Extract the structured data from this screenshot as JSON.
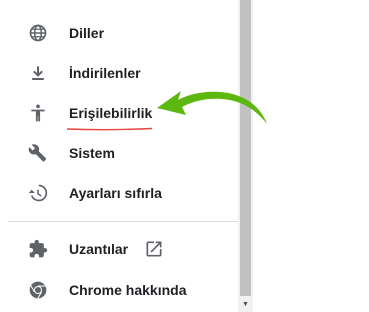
{
  "menu": {
    "items": [
      {
        "label": "Diller",
        "icon": "globe-icon"
      },
      {
        "label": "İndirilenler",
        "icon": "download-icon"
      },
      {
        "label": "Erişilebilirlik",
        "icon": "accessibility-icon"
      },
      {
        "label": "Sistem",
        "icon": "wrench-icon"
      },
      {
        "label": "Ayarları sıfırla",
        "icon": "restore-icon"
      }
    ],
    "bottom_items": [
      {
        "label": "Uzantılar",
        "icon": "puzzle-icon"
      },
      {
        "label": "Chrome hakkında",
        "icon": "chrome-logo-icon"
      }
    ]
  },
  "colors": {
    "text": "#202124",
    "icon": "#5f6368",
    "annotation_arrow": "#5cb80f",
    "annotation_underline": "#e8453c",
    "scrollbar_thumb": "#c1c1c1"
  }
}
